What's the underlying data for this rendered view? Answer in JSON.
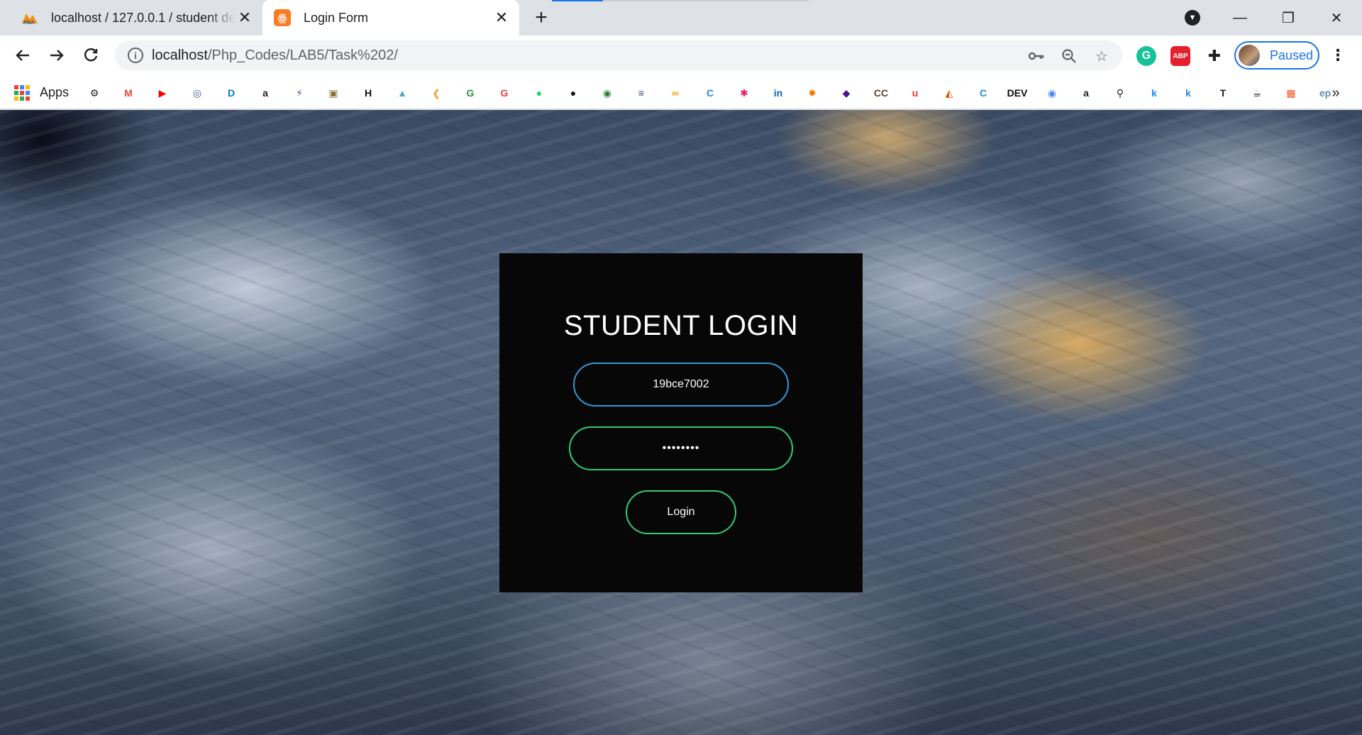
{
  "tabs": [
    {
      "title": "localhost / 127.0.0.1 / student de",
      "favicon": "phpmyadmin-icon",
      "active": false
    },
    {
      "title": "Login Form",
      "favicon": "xampp-icon",
      "active": true
    }
  ],
  "toolbar": {
    "url_host": "localhost",
    "url_path": "/Php_Codes/LAB5/Task%202/",
    "profile_label": "Paused"
  },
  "bookmarks": {
    "apps_label": "Apps",
    "items": [
      {
        "icon": "gear-icon",
        "glyph": "⚙",
        "color": "#202124"
      },
      {
        "icon": "gmail-icon",
        "glyph": "M",
        "color": "#ea4335"
      },
      {
        "icon": "youtube-icon",
        "glyph": "▶",
        "color": "#ff0000"
      },
      {
        "icon": "vit-icon",
        "glyph": "◎",
        "color": "#3b5a9a"
      },
      {
        "icon": "dell-icon",
        "glyph": "D",
        "color": "#007db8"
      },
      {
        "icon": "amazon-icon",
        "glyph": "a",
        "color": "#202124"
      },
      {
        "icon": "bolt-icon",
        "glyph": "⚡",
        "color": "#5b3ba6"
      },
      {
        "icon": "image-icon",
        "glyph": "▣",
        "color": "#8a6d3b"
      },
      {
        "icon": "hackerrank-icon",
        "glyph": "H",
        "color": "#0b0b0b"
      },
      {
        "icon": "mountain-icon",
        "glyph": "▲",
        "color": "#5aa0c8"
      },
      {
        "icon": "leetcode-icon",
        "glyph": "❮",
        "color": "#f89f1b"
      },
      {
        "icon": "gfg-icon",
        "glyph": "G",
        "color": "#2f8d46"
      },
      {
        "icon": "g-red-icon",
        "glyph": "G",
        "color": "#ea4335"
      },
      {
        "icon": "whatsapp-icon",
        "glyph": "●",
        "color": "#25d366"
      },
      {
        "icon": "github-icon",
        "glyph": "●",
        "color": "#181717"
      },
      {
        "icon": "codechef-icon",
        "glyph": "◉",
        "color": "#2e7d32"
      },
      {
        "icon": "stack-icon",
        "glyph": "≡",
        "color": "#3b4a7a"
      },
      {
        "icon": "coursera-icon",
        "glyph": "∞",
        "color": "#f2a900"
      },
      {
        "icon": "codeforces-icon",
        "glyph": "C",
        "color": "#1e88e5"
      },
      {
        "icon": "asterisk-icon",
        "glyph": "✱",
        "color": "#e91e63"
      },
      {
        "icon": "linkedin-icon",
        "glyph": "in",
        "color": "#0a66c2"
      },
      {
        "icon": "sun-icon",
        "glyph": "✹",
        "color": "#f57c00"
      },
      {
        "icon": "purple-icon",
        "glyph": "◆",
        "color": "#4a148c"
      },
      {
        "icon": "cc-icon",
        "glyph": "CC",
        "color": "#5d4037"
      },
      {
        "icon": "udemy-icon",
        "glyph": "u",
        "color": "#e53935"
      },
      {
        "icon": "matlab-icon",
        "glyph": "◭",
        "color": "#e65100"
      },
      {
        "icon": "canva-icon",
        "glyph": "C",
        "color": "#1e88e5"
      },
      {
        "icon": "dev-icon",
        "glyph": "DEV",
        "color": "#0a0a0a"
      },
      {
        "icon": "record-icon",
        "glyph": "◉",
        "color": "#4285f4"
      },
      {
        "icon": "amazon2-icon",
        "glyph": "a",
        "color": "#202124"
      },
      {
        "icon": "search-icon",
        "glyph": "⚲",
        "color": "#202124"
      },
      {
        "icon": "k-icon",
        "glyph": "k",
        "color": "#1e88e5"
      },
      {
        "icon": "k2-icon",
        "glyph": "k",
        "color": "#1e88e5"
      },
      {
        "icon": "t-icon",
        "glyph": "T",
        "color": "#202124"
      },
      {
        "icon": "coffee-icon",
        "glyph": "☕",
        "color": "#3e2723"
      },
      {
        "icon": "windows-icon",
        "glyph": "▦",
        "color": "#f25022"
      },
      {
        "icon": "ep-icon",
        "glyph": "ep",
        "color": "#5f8bb0"
      }
    ]
  },
  "page": {
    "title": "STUDENT LOGIN",
    "username_value": "19bce7002",
    "password_value": "••••••••",
    "login_label": "Login",
    "colors": {
      "card": "#070707",
      "user_border": "#3498db",
      "pass_border": "#2ecc71",
      "button_border": "#2ecc71"
    }
  }
}
